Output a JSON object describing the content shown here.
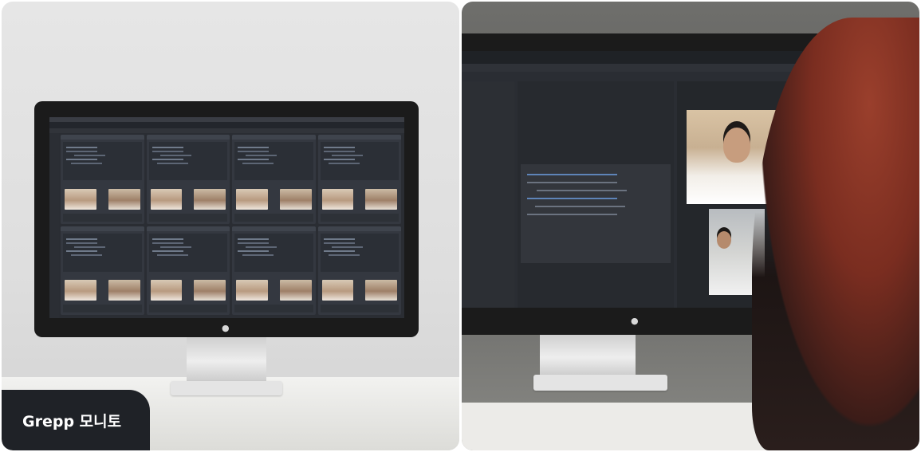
{
  "badge": {
    "text": "Grepp 모니토"
  },
  "colors": {
    "badge_bg": "#1f2227",
    "badge_text": "#ffffff",
    "screen_bg": "#2a2d33"
  },
  "left_panel": {
    "monitor_icon": "apple-logo-icon",
    "tile_count": 8
  },
  "right_panel": {
    "monitor_icon": "apple-logo-icon"
  }
}
